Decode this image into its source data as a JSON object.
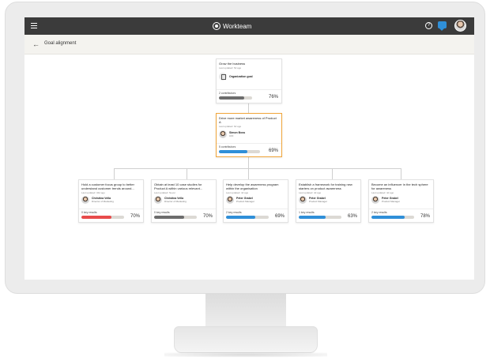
{
  "app": {
    "brand": "Workteam"
  },
  "topbar": {
    "help_label": "?"
  },
  "subheader": {
    "title": "Goal alignment"
  },
  "colors": {
    "blue": "#2f8fd8",
    "gray": "#6d6d6d",
    "red": "#e84b4b",
    "accent": "#f0a53a"
  },
  "goals": {
    "root": {
      "title": "Grow the business",
      "updated": "Last updated: 5d ago",
      "owner": "Organization goal",
      "footer_label": "2 contributors",
      "progress_label": "76%",
      "progress": 0.76,
      "bar_color": "#6d6d6d"
    },
    "mid": {
      "title": "Drive more market awareness of Product A",
      "updated": "Last updated: 6d ago",
      "owner_name": "Simon Boss",
      "owner_role": "CIO",
      "footer_label": "5 contributors",
      "progress_label": "69%",
      "progress": 0.69,
      "bar_color": "#2f8fd8"
    },
    "children": [
      {
        "title": "Hold a customer focus group to better understand customer trends around...",
        "updated": "Last updated: 34d ago",
        "owner_name": "Christina Vella",
        "owner_role": "Director of Marketing",
        "footer_label": "0 key results",
        "progress_label": "70%",
        "progress": 0.7,
        "bar_color": "#e84b4b"
      },
      {
        "title": "Obtain at least 10 case studies for Product A within various relevant...",
        "updated": "Last updated: Never",
        "owner_name": "Christina Vella",
        "owner_role": "Director of Marketing",
        "footer_label": "0 key results",
        "progress_label": "70%",
        "progress": 0.7,
        "bar_color": "#6d6d6d"
      },
      {
        "title": "Help develop the awareness program within the organisation",
        "updated": "Last updated: 4d ago",
        "owner_name": "Peter Grabel",
        "owner_role": "Product Manager",
        "footer_label": "2 key results",
        "progress_label": "69%",
        "progress": 0.69,
        "bar_color": "#2f8fd8"
      },
      {
        "title": "Establish a framework for training new starters on product awareness",
        "updated": "Last updated: 4d ago",
        "owner_name": "Peter Grabel",
        "owner_role": "Product Manager",
        "footer_label": "1 key results",
        "progress_label": "63%",
        "progress": 0.63,
        "bar_color": "#2f8fd8"
      },
      {
        "title": "Become an influencer in the tech sphere for awareness",
        "updated": "Last updated: 4d ago",
        "owner_name": "Peter Grabel",
        "owner_role": "Product Manager",
        "footer_label": "2 key results",
        "progress_label": "78%",
        "progress": 0.78,
        "bar_color": "#2f8fd8"
      }
    ]
  }
}
